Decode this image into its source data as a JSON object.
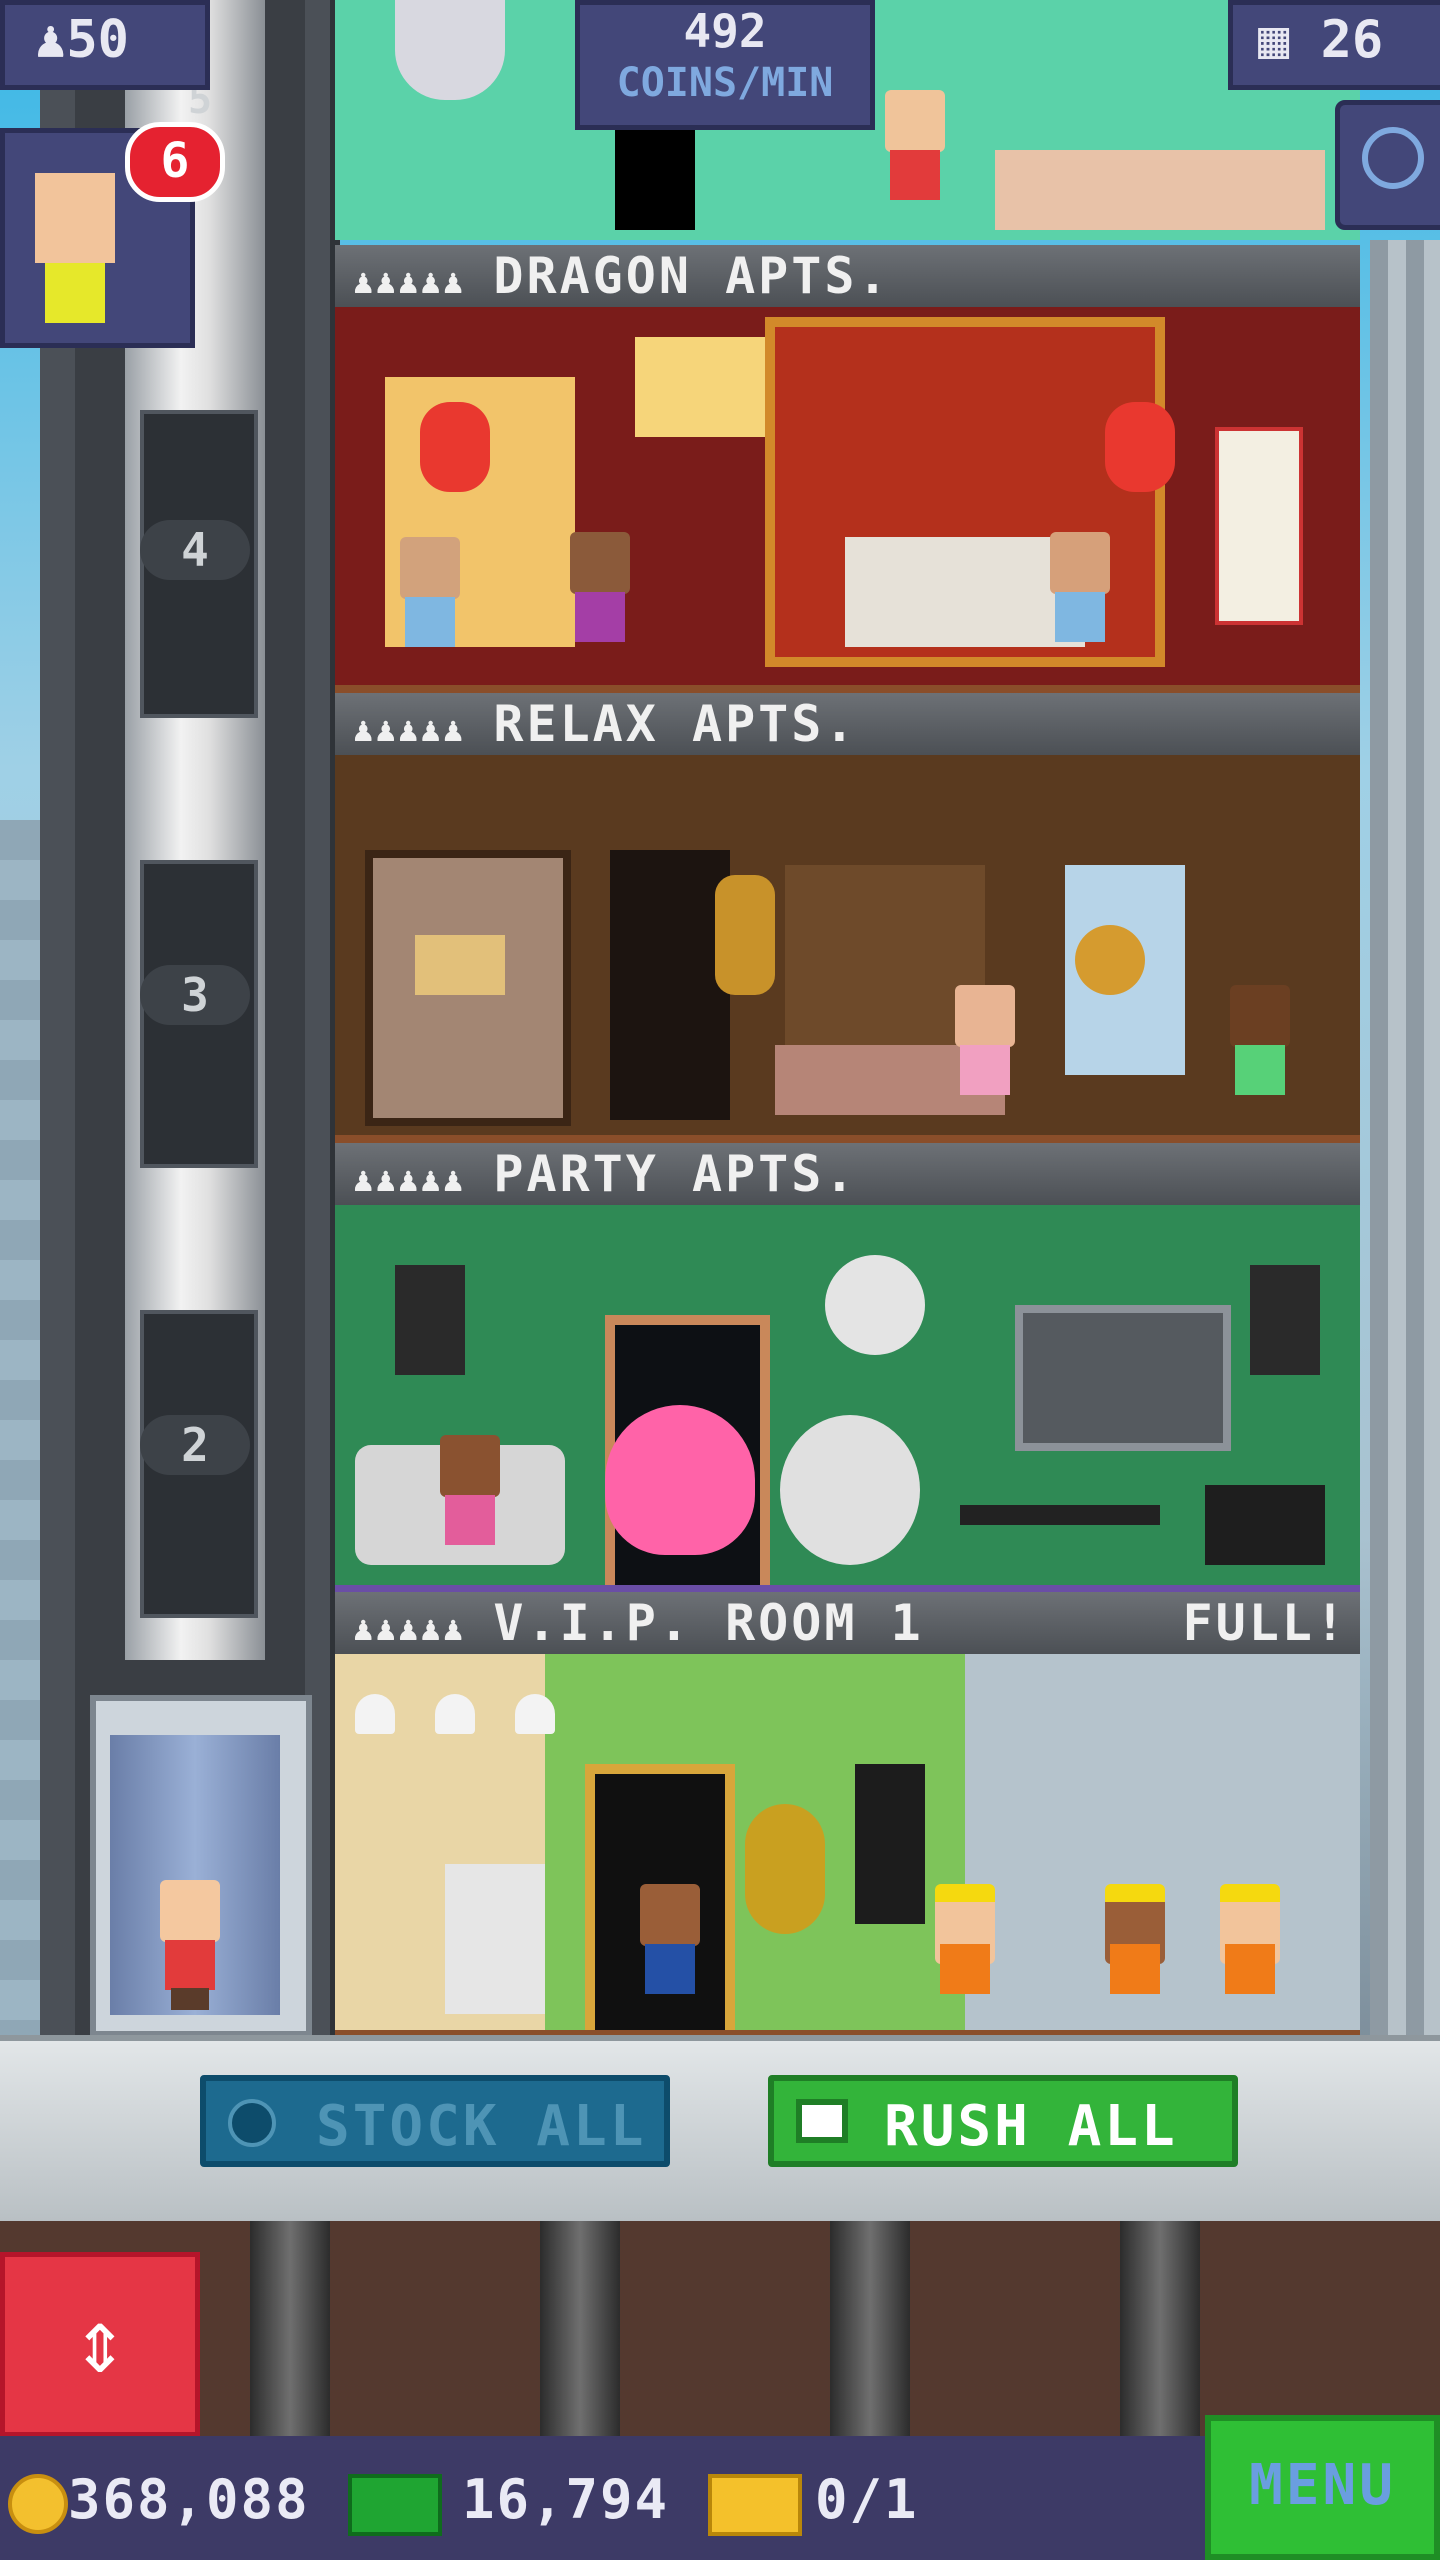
{
  "hud": {
    "population": "50",
    "coins_per_min_value": "492",
    "coins_per_min_label": "COINS/MIN",
    "floors_count": "26",
    "notification_count": "6"
  },
  "elevator": {
    "floor_numbers": [
      "5",
      "4",
      "3",
      "2"
    ]
  },
  "floors": [
    {
      "name": "DRAGON APTS.",
      "occupancy_icons": "♟♟♟♟♟",
      "status": ""
    },
    {
      "name": "RELAX APTS.",
      "occupancy_icons": "♟♟♟♟♟",
      "status": ""
    },
    {
      "name": "PARTY APTS.",
      "occupancy_icons": "♟♟♟♟♟",
      "status": ""
    },
    {
      "name": "V.I.P. ROOM 1",
      "occupancy_icons": "♟♟♟♟♟",
      "status": "FULL!"
    }
  ],
  "actions": {
    "stock_all": "STOCK ALL",
    "rush_all": "RUSH ALL"
  },
  "bottom": {
    "coins": "368,088",
    "bux": "16,794",
    "tickets": "0/1",
    "menu": "MENU"
  },
  "colors": {
    "dragon_room": "#7a1c1a",
    "relax_room": "#5a3a1f",
    "party_room": "#2f8a55",
    "vip_room": "#7ec45a",
    "rush_green": "#33b43a",
    "stock_blue": "#1d6a8f"
  }
}
